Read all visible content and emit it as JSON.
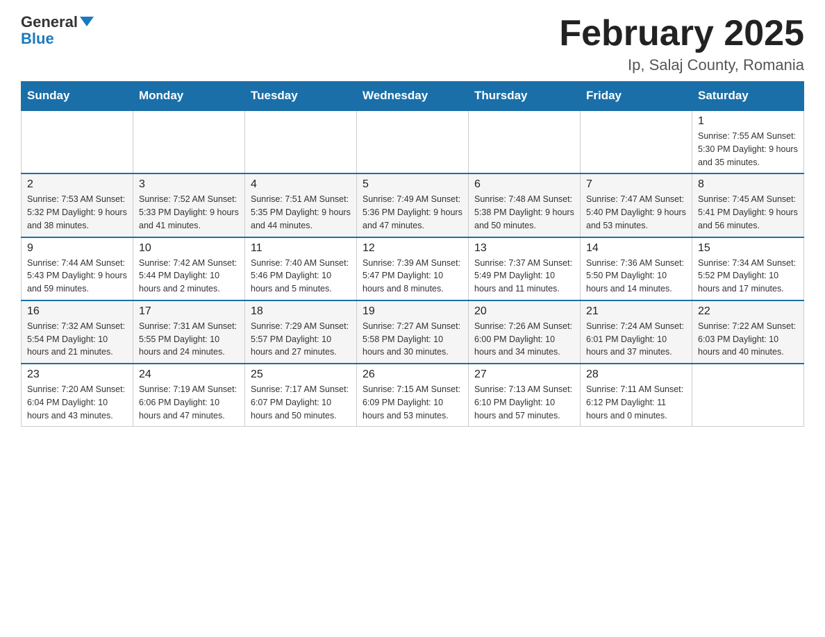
{
  "logo": {
    "general": "General",
    "blue": "Blue"
  },
  "title": "February 2025",
  "subtitle": "Ip, Salaj County, Romania",
  "days": [
    "Sunday",
    "Monday",
    "Tuesday",
    "Wednesday",
    "Thursday",
    "Friday",
    "Saturday"
  ],
  "weeks": [
    [
      {
        "day": "",
        "info": ""
      },
      {
        "day": "",
        "info": ""
      },
      {
        "day": "",
        "info": ""
      },
      {
        "day": "",
        "info": ""
      },
      {
        "day": "",
        "info": ""
      },
      {
        "day": "",
        "info": ""
      },
      {
        "day": "1",
        "info": "Sunrise: 7:55 AM\nSunset: 5:30 PM\nDaylight: 9 hours\nand 35 minutes."
      }
    ],
    [
      {
        "day": "2",
        "info": "Sunrise: 7:53 AM\nSunset: 5:32 PM\nDaylight: 9 hours\nand 38 minutes."
      },
      {
        "day": "3",
        "info": "Sunrise: 7:52 AM\nSunset: 5:33 PM\nDaylight: 9 hours\nand 41 minutes."
      },
      {
        "day": "4",
        "info": "Sunrise: 7:51 AM\nSunset: 5:35 PM\nDaylight: 9 hours\nand 44 minutes."
      },
      {
        "day": "5",
        "info": "Sunrise: 7:49 AM\nSunset: 5:36 PM\nDaylight: 9 hours\nand 47 minutes."
      },
      {
        "day": "6",
        "info": "Sunrise: 7:48 AM\nSunset: 5:38 PM\nDaylight: 9 hours\nand 50 minutes."
      },
      {
        "day": "7",
        "info": "Sunrise: 7:47 AM\nSunset: 5:40 PM\nDaylight: 9 hours\nand 53 minutes."
      },
      {
        "day": "8",
        "info": "Sunrise: 7:45 AM\nSunset: 5:41 PM\nDaylight: 9 hours\nand 56 minutes."
      }
    ],
    [
      {
        "day": "9",
        "info": "Sunrise: 7:44 AM\nSunset: 5:43 PM\nDaylight: 9 hours\nand 59 minutes."
      },
      {
        "day": "10",
        "info": "Sunrise: 7:42 AM\nSunset: 5:44 PM\nDaylight: 10 hours\nand 2 minutes."
      },
      {
        "day": "11",
        "info": "Sunrise: 7:40 AM\nSunset: 5:46 PM\nDaylight: 10 hours\nand 5 minutes."
      },
      {
        "day": "12",
        "info": "Sunrise: 7:39 AM\nSunset: 5:47 PM\nDaylight: 10 hours\nand 8 minutes."
      },
      {
        "day": "13",
        "info": "Sunrise: 7:37 AM\nSunset: 5:49 PM\nDaylight: 10 hours\nand 11 minutes."
      },
      {
        "day": "14",
        "info": "Sunrise: 7:36 AM\nSunset: 5:50 PM\nDaylight: 10 hours\nand 14 minutes."
      },
      {
        "day": "15",
        "info": "Sunrise: 7:34 AM\nSunset: 5:52 PM\nDaylight: 10 hours\nand 17 minutes."
      }
    ],
    [
      {
        "day": "16",
        "info": "Sunrise: 7:32 AM\nSunset: 5:54 PM\nDaylight: 10 hours\nand 21 minutes."
      },
      {
        "day": "17",
        "info": "Sunrise: 7:31 AM\nSunset: 5:55 PM\nDaylight: 10 hours\nand 24 minutes."
      },
      {
        "day": "18",
        "info": "Sunrise: 7:29 AM\nSunset: 5:57 PM\nDaylight: 10 hours\nand 27 minutes."
      },
      {
        "day": "19",
        "info": "Sunrise: 7:27 AM\nSunset: 5:58 PM\nDaylight: 10 hours\nand 30 minutes."
      },
      {
        "day": "20",
        "info": "Sunrise: 7:26 AM\nSunset: 6:00 PM\nDaylight: 10 hours\nand 34 minutes."
      },
      {
        "day": "21",
        "info": "Sunrise: 7:24 AM\nSunset: 6:01 PM\nDaylight: 10 hours\nand 37 minutes."
      },
      {
        "day": "22",
        "info": "Sunrise: 7:22 AM\nSunset: 6:03 PM\nDaylight: 10 hours\nand 40 minutes."
      }
    ],
    [
      {
        "day": "23",
        "info": "Sunrise: 7:20 AM\nSunset: 6:04 PM\nDaylight: 10 hours\nand 43 minutes."
      },
      {
        "day": "24",
        "info": "Sunrise: 7:19 AM\nSunset: 6:06 PM\nDaylight: 10 hours\nand 47 minutes."
      },
      {
        "day": "25",
        "info": "Sunrise: 7:17 AM\nSunset: 6:07 PM\nDaylight: 10 hours\nand 50 minutes."
      },
      {
        "day": "26",
        "info": "Sunrise: 7:15 AM\nSunset: 6:09 PM\nDaylight: 10 hours\nand 53 minutes."
      },
      {
        "day": "27",
        "info": "Sunrise: 7:13 AM\nSunset: 6:10 PM\nDaylight: 10 hours\nand 57 minutes."
      },
      {
        "day": "28",
        "info": "Sunrise: 7:11 AM\nSunset: 6:12 PM\nDaylight: 11 hours\nand 0 minutes."
      },
      {
        "day": "",
        "info": ""
      }
    ]
  ]
}
